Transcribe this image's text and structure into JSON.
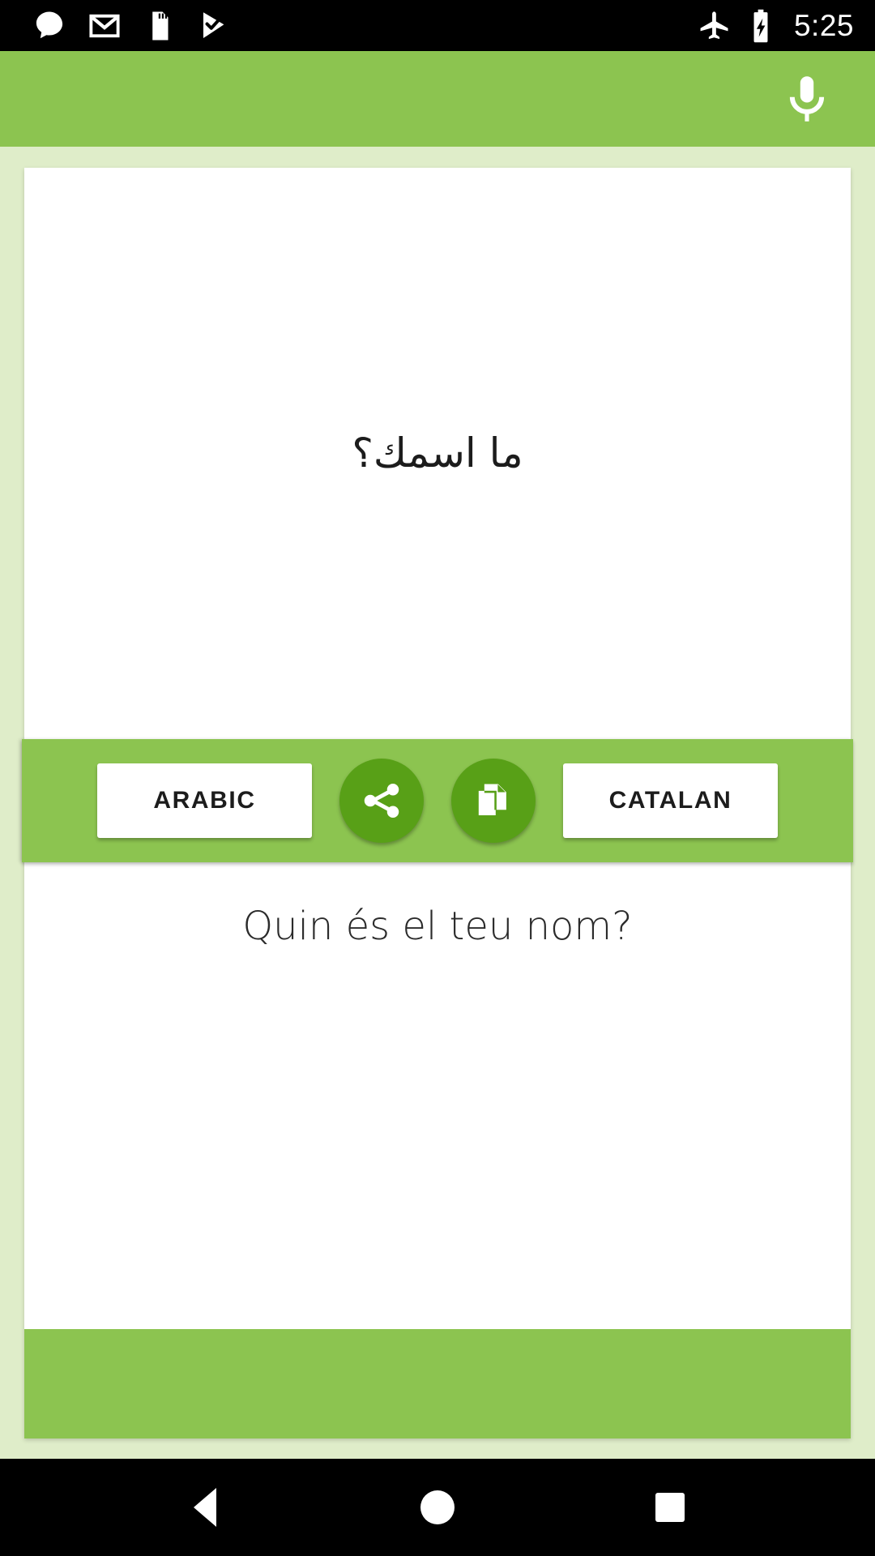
{
  "status_bar": {
    "icons_left": [
      "message-bubble-icon",
      "gmail-icon",
      "sd-card-icon",
      "play-checkmark-icon"
    ],
    "icons_right": [
      "airplane-mode-icon",
      "battery-charging-icon"
    ],
    "time": "5:25",
    "background_color": "#000000",
    "foreground_color": "#ffffff"
  },
  "app_header": {
    "mic_icon": "microphone-icon",
    "background_color": "#8cc450"
  },
  "theme": {
    "accent_green": "#8cc450",
    "dark_green": "#58a017",
    "page_background": "#dfedc9",
    "card_background": "#ffffff",
    "text_color": "#1c1c1c"
  },
  "translator": {
    "source": {
      "language_label": "ARABIC",
      "text": "ما اسمك؟",
      "direction": "rtl"
    },
    "target": {
      "language_label": "CATALAN",
      "text": "Quin és el teu nom?",
      "direction": "ltr"
    },
    "actions": [
      {
        "name": "share",
        "icon": "share-icon"
      },
      {
        "name": "copy",
        "icon": "copy-icon"
      }
    ]
  },
  "nav_bar": {
    "back_label": "Back",
    "home_label": "Home",
    "recents_label": "Recents"
  }
}
